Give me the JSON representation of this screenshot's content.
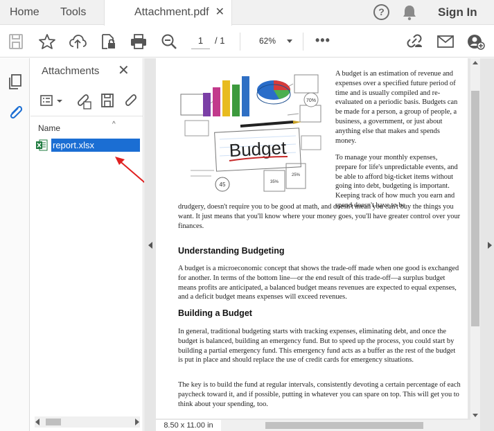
{
  "tabs": {
    "home": "Home",
    "tools": "Tools",
    "document": "Attachment.pdf",
    "close": "✕"
  },
  "header": {
    "help": "?",
    "sign_in": "Sign In"
  },
  "toolbar": {
    "page_current": "1",
    "page_total": "/   1",
    "zoom": "62%",
    "more": "•••"
  },
  "attachments_panel": {
    "title": "Attachments",
    "close": "✕",
    "column_name": "Name",
    "sort_indicator": "^",
    "files": [
      {
        "name": "report.xlsx",
        "type": "excel",
        "selected": true
      }
    ]
  },
  "document": {
    "page_size": "8.50 x 11.00 in",
    "illustration_word": "Budget",
    "illustration_badges": [
      "70%",
      "45",
      "35%",
      "25%"
    ],
    "side_paragraph_1": "A budget is an estimation of revenue and expenses over a specified future period of time and is usually compiled and re-evaluated on a periodic basis. Budgets can be made for a person, a group of people, a business, a government, or just about anything else that makes and spends money.",
    "side_paragraph_2": "To manage your monthly expenses, prepare for life's unpredictable events, and be able to afford big-ticket items without going into debt, budgeting is important. Keeping track of how much you earn and spend doesn't have to be",
    "paragraph_2_cont": "drudgery, doesn't require you to be good at math, and doesn't mean you can't buy the things you want. It just means that you'll know where your money goes, you'll have greater control over your finances.",
    "heading_1": "Understanding Budgeting",
    "paragraph_3": "A budget is a microeconomic concept that shows the trade-off made when one good is exchanged for another. In terms of the bottom line—or the end result of this trade-off—a surplus budget means profits are anticipated, a balanced budget means revenues are expected to equal expenses, and a deficit budget means expenses will exceed revenues.",
    "heading_2": "Building a Budget",
    "paragraph_4": "In general, traditional budgeting starts with tracking expenses, eliminating debt, and once the budget is balanced, building an emergency fund. But to speed up the process, you could start by building a partial emergency fund. This emergency fund acts as a buffer as the rest of the budget is put in place and should replace the use of credit cards for emergency situations.",
    "paragraph_5": "The key is to build the fund at regular intervals, consistently devoting a certain percentage of each paycheck toward it, and if possible, putting in whatever you can spare on top. This will get you to think about your spending, too."
  },
  "colors": {
    "selection": "#1b6ed3",
    "annotation_arrow": "#e02020",
    "excel_green": "#1d7a3e"
  }
}
